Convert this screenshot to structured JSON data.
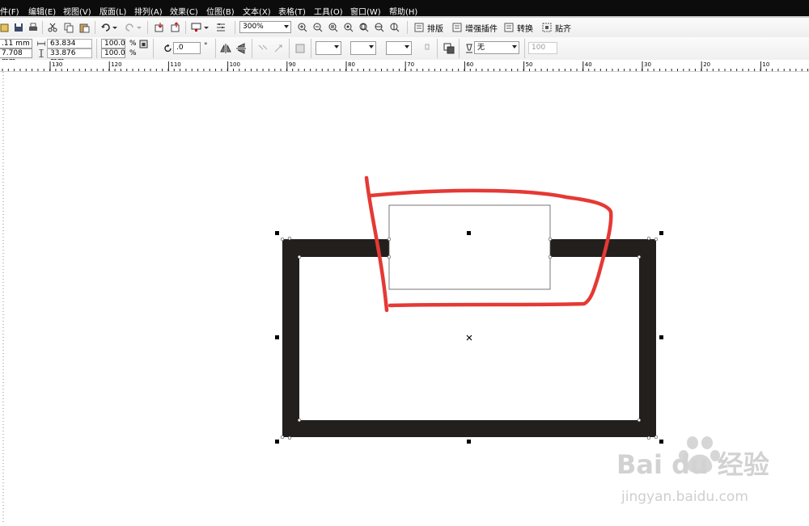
{
  "menu": [
    "件(F)",
    "编辑(E)",
    "视图(V)",
    "版面(L)",
    "排列(A)",
    "效果(C)",
    "位图(B)",
    "文本(X)",
    "表格(T)",
    "工具(O)",
    "窗口(W)",
    "帮助(H)"
  ],
  "toolbar": {
    "zoom": "300%",
    "tools": [
      "排版",
      "增强插件",
      "转换",
      "贴齐"
    ]
  },
  "properties": {
    "x": ".11 mm",
    "y": "7.708 mm",
    "width": "63.834 mm",
    "height": "33.876 mm",
    "scale_x": "100.0",
    "scale_y": "100.0",
    "percent": "%",
    "rotation": ".0",
    "degree": "°",
    "outline": "无",
    "outline_width": "100"
  },
  "ruler": {
    "labels": [
      "130",
      "120",
      "110",
      "100",
      "90",
      "80",
      "70",
      "60",
      "50",
      "40",
      "30",
      "20",
      "10"
    ]
  },
  "watermark": {
    "brand": "Bai du 经验",
    "url": "jingyan.baidu.com"
  },
  "colors": {
    "frame": "#231f1c",
    "annotation": "#e53935",
    "menubar": "#0c0c0c"
  }
}
